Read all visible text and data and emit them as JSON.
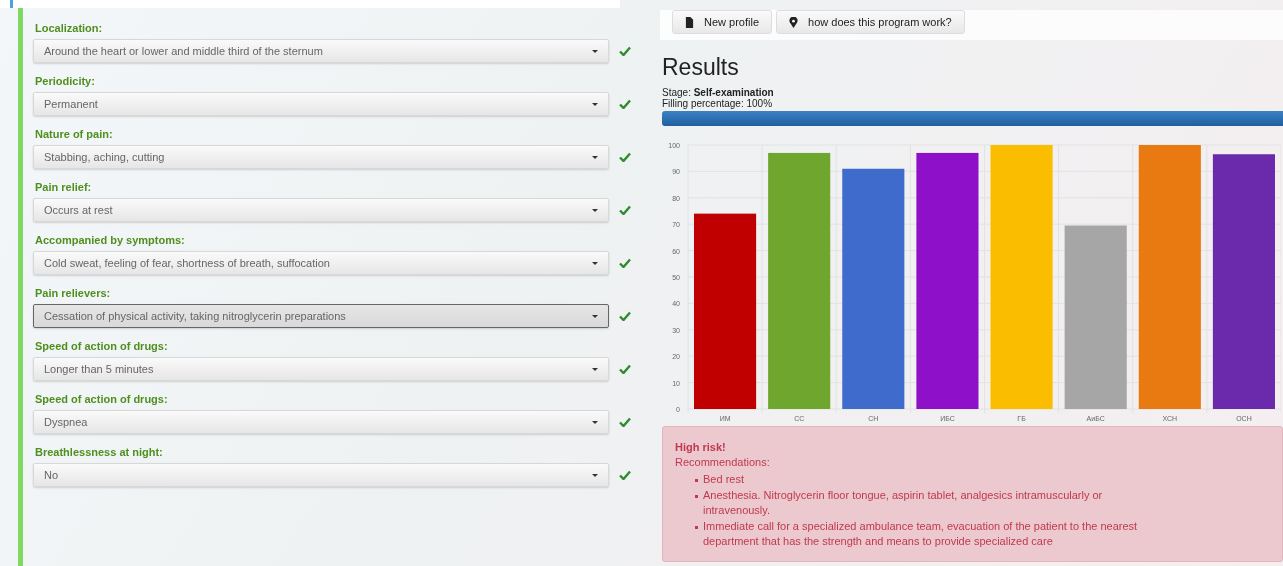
{
  "questionnaire": {
    "fields": [
      {
        "label": "Localization:",
        "value": "Around the heart or lower and middle third of the sternum",
        "focused": false,
        "valid": true
      },
      {
        "label": "Periodicity:",
        "value": "Permanent",
        "focused": false,
        "valid": true
      },
      {
        "label": "Nature of pain:",
        "value": "Stabbing, aching, cutting",
        "focused": false,
        "valid": true
      },
      {
        "label": "Pain relief:",
        "value": "Occurs at rest",
        "focused": false,
        "valid": true
      },
      {
        "label": "Accompanied by symptoms:",
        "value": "Cold sweat, feeling of fear, shortness of breath, suffocation",
        "focused": false,
        "valid": true
      },
      {
        "label": "Pain relievers:",
        "value": "Cessation of physical activity, taking nitroglycerin preparations",
        "focused": true,
        "valid": true
      },
      {
        "label": "Speed of action of drugs:",
        "value": "Longer than 5 minutes",
        "focused": false,
        "valid": true
      },
      {
        "label": "Speed of action of drugs:",
        "value": "Dyspnea",
        "focused": false,
        "valid": true
      },
      {
        "label": "Breathlessness at night:",
        "value": "No",
        "focused": false,
        "valid": true
      }
    ]
  },
  "toolbar": {
    "buttons": [
      {
        "label": "New profile",
        "kind": "document"
      },
      {
        "label": "how does this program work?",
        "kind": "help"
      }
    ]
  },
  "results": {
    "title": "Results",
    "stage_label": "Stage: ",
    "stage": "Self-examination",
    "filling": "Filling percentage: 100%",
    "level": 1.0,
    "chart_data": {
      "type": "bar",
      "categories": [
        "ИМ",
        "СС",
        "СН",
        "ИБС",
        "ГБ",
        "АиБС",
        "ХСН",
        "ОСН"
      ],
      "values": [
        74,
        97,
        91,
        97,
        100,
        69.5,
        100,
        96.5
      ],
      "grid": true,
      "colors": [
        "#c00000",
        "#6ea62e",
        "#3f6ccc",
        "#8e10c8",
        "#fbbd00",
        "#a6a6a6",
        "#e97a12",
        "#6a2aab"
      ],
      "ylim": [
        0,
        100
      ],
      "yticks": [
        0,
        10,
        20,
        30,
        40,
        50,
        60,
        70,
        80,
        90,
        100
      ]
    },
    "alert": {
      "title": "High risk!",
      "subtitle": "Recommendations:",
      "items": [
        "Bed rest",
        "Anesthesia. Nitroglycerin floor tongue, aspirin tablet, analgesics intramuscularly or intravenously.",
        "Immediate call for a specialized ambulance team, evacuation of the patient to the nearest department that has the strength and means to provide specialized care"
      ]
    }
  }
}
